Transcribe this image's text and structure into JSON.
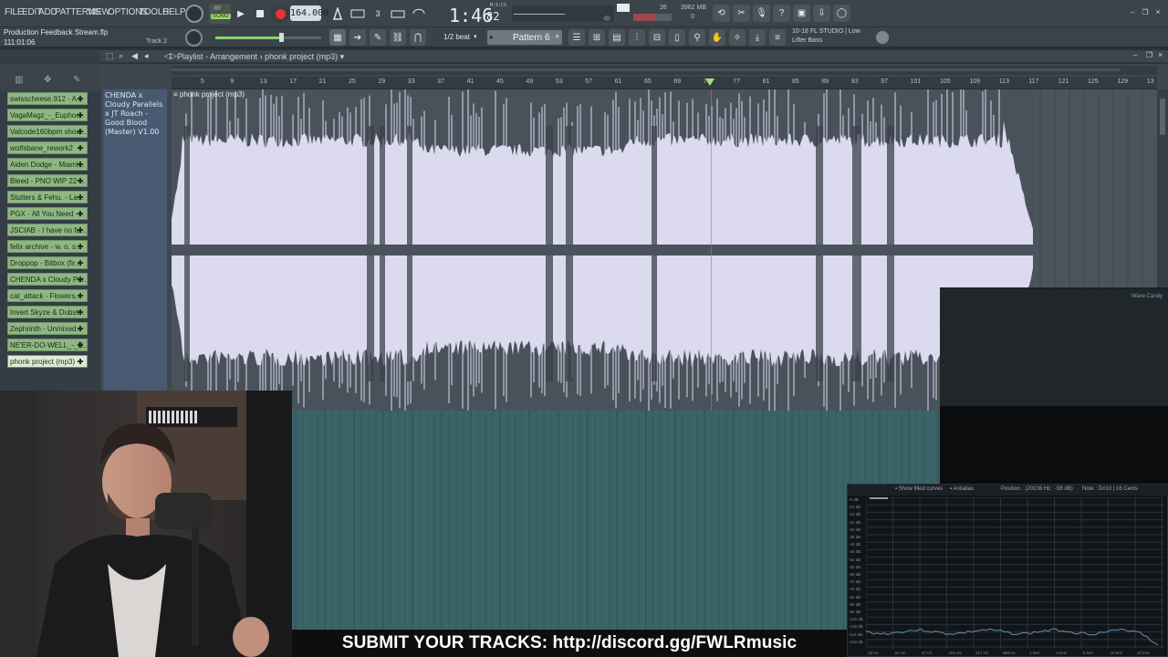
{
  "menu": [
    "FILE",
    "EDIT",
    "ADD",
    "PATTERNS",
    "VIEW",
    "OPTIONS",
    "TOOLS",
    "HELP"
  ],
  "transport": {
    "song_label": "SONG",
    "tempo": "164.000",
    "time": "1:46",
    "time_fraction": "82",
    "time_units": "M:S:CS",
    "cpu": "26",
    "memory": "3962 MB",
    "voices": "0"
  },
  "project": {
    "file_title": "Production Feedback Stream.flp",
    "position": "111:01:06",
    "track_hint": "Track 2"
  },
  "snap": "1/2 beat",
  "pattern": "Pattern 6",
  "hint_bar": {
    "line1": "10-18  FL STUDIO | Low",
    "line2": "Lifter Bass"
  },
  "playlist": {
    "title": "Playlist - Arrangement",
    "separator": "›",
    "project_name": "phonk project (mp3)",
    "track_header": "CHENDA x Cloudy Parallels x JT Roach - Good Blood (Master) V1.00",
    "clip_label": "phonk project (mp3)",
    "ruler": [
      "5",
      "9",
      "13",
      "17",
      "21",
      "25",
      "29",
      "33",
      "37",
      "41",
      "45",
      "49",
      "53",
      "57",
      "61",
      "65",
      "69",
      "73",
      "77",
      "81",
      "85",
      "89",
      "93",
      "97",
      "101",
      "105",
      "109",
      "113",
      "117",
      "121",
      "125",
      "129",
      "13"
    ]
  },
  "tracks": [
    "swisscheese.912 - A...",
    "VagaMagz_-_Euphor...",
    "Valcode160bpm shou...",
    "wolfsbane_rework2",
    "Aiden Dodge - Miami...",
    "Bleed - PNO WIP 22-...",
    "Stutters & Fehu. - La...",
    "PGX - All You Need -...",
    "JSCIAB - I have no fu...",
    "felix archive - w. o. s...",
    "Droppop - Bitbox (fir...",
    "CHENDA x Cloudy Par...",
    "cat_attack - Flowers...",
    "Invert Skyze & Dubst...",
    "Zephrinth - Unmixed...",
    "NE'ER-DO-WELL_-_R...",
    "phonk project (mp3)"
  ],
  "wave_candy": {
    "title": "Wave Candy"
  },
  "analyzer": {
    "show_filled": "Show filled curves",
    "antialias": "Antialias",
    "position": "Position : (20108 Hz : -58 dB)",
    "note": "Note : D#10 | 16 Cents",
    "db_labels": [
      "-6 dB",
      "-12 dB",
      "-18 dB",
      "-24 dB",
      "-30 dB",
      "-36 dB",
      "-42 dB",
      "-48 dB",
      "-54 dB",
      "-60 dB",
      "-66 dB",
      "-72 dB",
      "-78 dB",
      "-84 dB",
      "-90 dB",
      "-96 dB",
      "-102 dB",
      "-108 dB",
      "-114 dB",
      "-120 dB"
    ],
    "freq_labels": [
      "15 Hz",
      "22 Hz",
      "47 Hz",
      "101 Hz",
      "217 Hz",
      "468 Hz",
      "1 kHz",
      "2 kHz",
      "5 kHz",
      "10 kHz",
      "20 kHz"
    ]
  },
  "banner": "SUBMIT YOUR TRACKS: http://discord.gg/FWLRmusic",
  "colors": {
    "track_button": "#8fb784",
    "waveform": "#dcdaee",
    "clip_bg": "#49525b"
  }
}
